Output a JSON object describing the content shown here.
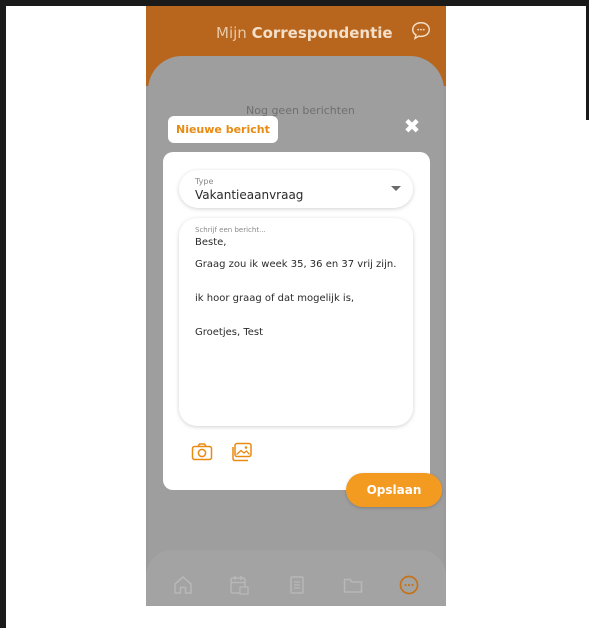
{
  "header": {
    "title_prefix": "Mijn",
    "title_bold": "Correspondentie"
  },
  "empty_state": "Nog geen berichten",
  "modal": {
    "tag": "Nieuwe bericht",
    "close_symbol": "✖",
    "type_field": {
      "caption": "Type",
      "value": "Vakantieaanvraag"
    },
    "message_field": {
      "placeholder": "Schrijf een bericht...",
      "lines": [
        "Beste,",
        "Graag zou ik week 35, 36 en 37 vrij zijn.",
        "ik hoor graag of dat mogelijk is,",
        "Groetjes, Test"
      ]
    },
    "attachments": [
      "camera-icon",
      "gallery-icon"
    ],
    "save_label": "Opslaan"
  },
  "bottom_nav": {
    "items": [
      "home-icon",
      "calendar-icon",
      "document-icon",
      "folder-icon",
      "chat-icon"
    ],
    "active": "chat-icon"
  },
  "colors": {
    "accent": "#f39a21",
    "header_bg": "#b8651e",
    "overlay": "#9e9e9e"
  }
}
